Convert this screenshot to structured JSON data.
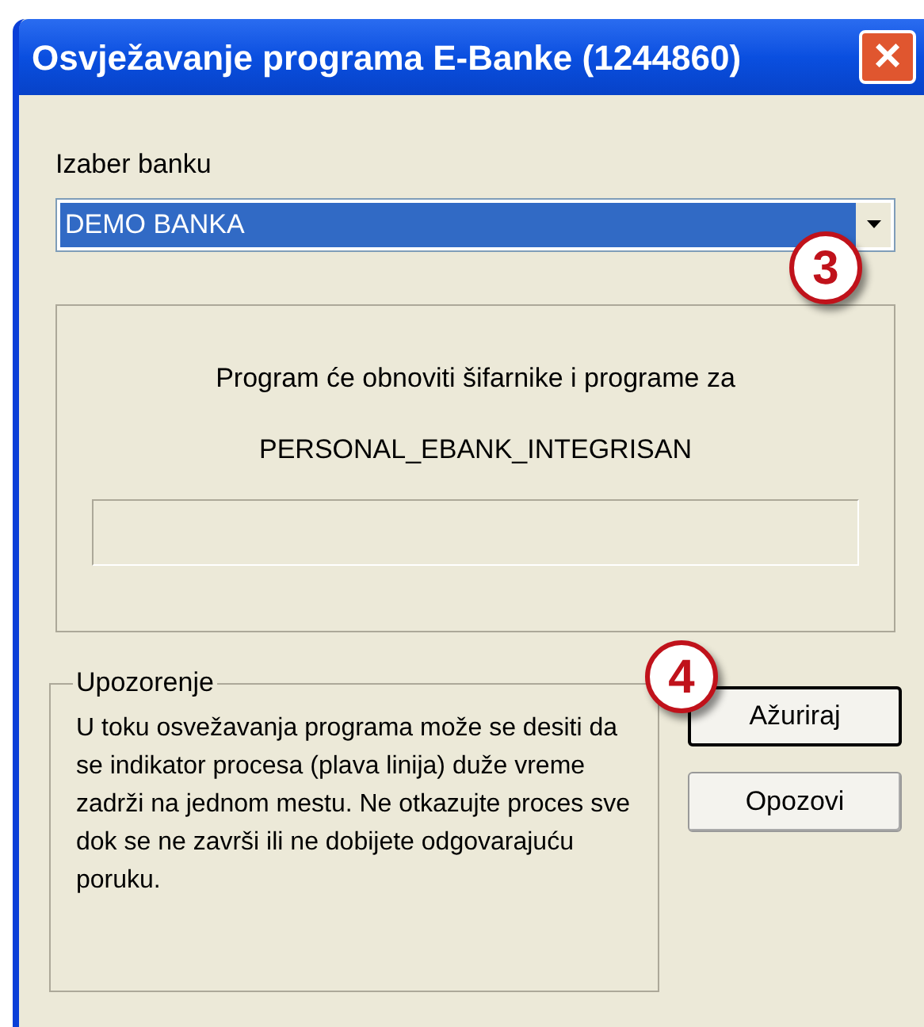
{
  "window": {
    "title": "Osvježavanje programa E-Banke (1244860)",
    "close": "×"
  },
  "bank_select": {
    "label": "Izaber banku",
    "value": "DEMO BANKA",
    "selected": true
  },
  "info": {
    "line_1": "Program će obnoviti šifarnike i programe za",
    "line_2": "PERSONAL_EBANK_INTEGRISAN",
    "progress": {
      "level": 0
    }
  },
  "warning": {
    "title": "Upozorenje",
    "text": "U toku osvežavanja programa može se desiti da se indikator procesa (plava linija) duže vreme zadrži na jednom mestu. Ne otkazujte proces sve dok se ne završi ili ne dobijete odgovarajuću poruku."
  },
  "buttons": [
    {
      "label": "Ažuriraj",
      "default": true
    },
    {
      "label": "Opozovi",
      "default": false
    }
  ],
  "callouts": [
    {
      "label": "3"
    },
    {
      "label": "4"
    }
  ]
}
